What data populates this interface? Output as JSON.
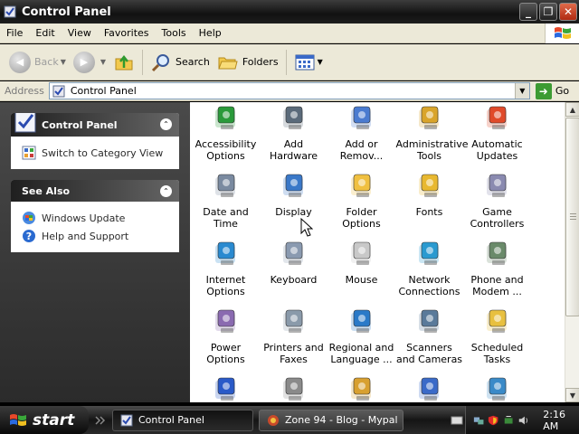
{
  "window": {
    "title": "Control Panel"
  },
  "menubar": {
    "items": [
      "File",
      "Edit",
      "View",
      "Favorites",
      "Tools",
      "Help"
    ]
  },
  "toolbar": {
    "back_label": "Back",
    "search_label": "Search",
    "folders_label": "Folders"
  },
  "address": {
    "label": "Address",
    "value": "Control Panel",
    "go_label": "Go"
  },
  "tasks_panel": {
    "title": "Control Panel",
    "items": [
      {
        "label": "Switch to Category View",
        "icon": "category-view-icon"
      }
    ]
  },
  "see_also_panel": {
    "title": "See Also",
    "items": [
      {
        "label": "Windows Update",
        "icon": "windows-update-icon"
      },
      {
        "label": "Help and Support",
        "icon": "help-icon"
      }
    ]
  },
  "control_panel_items": [
    {
      "label": "Accessibility Options",
      "icon": "accessibility-icon",
      "color": "#2a9a3a"
    },
    {
      "label": "Add Hardware",
      "icon": "add-hardware-icon",
      "color": "#5a6a7a"
    },
    {
      "label": "Add or Remov...",
      "icon": "add-remove-icon",
      "color": "#4a7bd0"
    },
    {
      "label": "Administrative Tools",
      "icon": "admin-tools-icon",
      "color": "#d9a42b"
    },
    {
      "label": "Automatic Updates",
      "icon": "automatic-updates-icon",
      "color": "#e04a2a"
    },
    {
      "label": "Date and Time",
      "icon": "clock-icon",
      "color": "#7a8aa0"
    },
    {
      "label": "Display",
      "icon": "display-icon",
      "color": "#3a78c8"
    },
    {
      "label": "Folder Options",
      "icon": "folder-options-icon",
      "color": "#f0c040"
    },
    {
      "label": "Fonts",
      "icon": "fonts-icon",
      "color": "#e8b830"
    },
    {
      "label": "Game Controllers",
      "icon": "game-controller-icon",
      "color": "#8a8ab0"
    },
    {
      "label": "Internet Options",
      "icon": "internet-options-icon",
      "color": "#2a8ad0"
    },
    {
      "label": "Keyboard",
      "icon": "keyboard-icon",
      "color": "#8a9ab0"
    },
    {
      "label": "Mouse",
      "icon": "mouse-icon",
      "color": "#c8c8c8"
    },
    {
      "label": "Network Connections",
      "icon": "network-icon",
      "color": "#2a9ad0"
    },
    {
      "label": "Phone and Modem ...",
      "icon": "phone-icon",
      "color": "#6a8a6a"
    },
    {
      "label": "Power Options",
      "icon": "power-icon",
      "color": "#8a6ab0"
    },
    {
      "label": "Printers and Faxes",
      "icon": "printer-icon",
      "color": "#8a9aaa"
    },
    {
      "label": "Regional and Language ...",
      "icon": "globe-icon",
      "color": "#2a7ac8"
    },
    {
      "label": "Scanners and Cameras",
      "icon": "scanner-icon",
      "color": "#5a7a9a"
    },
    {
      "label": "Scheduled Tasks",
      "icon": "scheduled-tasks-icon",
      "color": "#e8c040"
    },
    {
      "label": "",
      "icon": "security-center-icon",
      "color": "#2a5ac8"
    },
    {
      "label": "",
      "icon": "sounds-icon",
      "color": "#8a8a8a"
    },
    {
      "label": "",
      "icon": "speech-icon",
      "color": "#d8a030"
    },
    {
      "label": "",
      "icon": "system-icon",
      "color": "#3a6ac8"
    },
    {
      "label": "",
      "icon": "taskbar-icon",
      "color": "#3a8ac8"
    }
  ],
  "taskbar": {
    "start_label": "start",
    "buttons": [
      {
        "label": "Control Panel",
        "state": "active"
      },
      {
        "label": "Zone 94 - Blog - Mypal",
        "state": "inactive"
      }
    ],
    "clock": "2:16 AM"
  }
}
